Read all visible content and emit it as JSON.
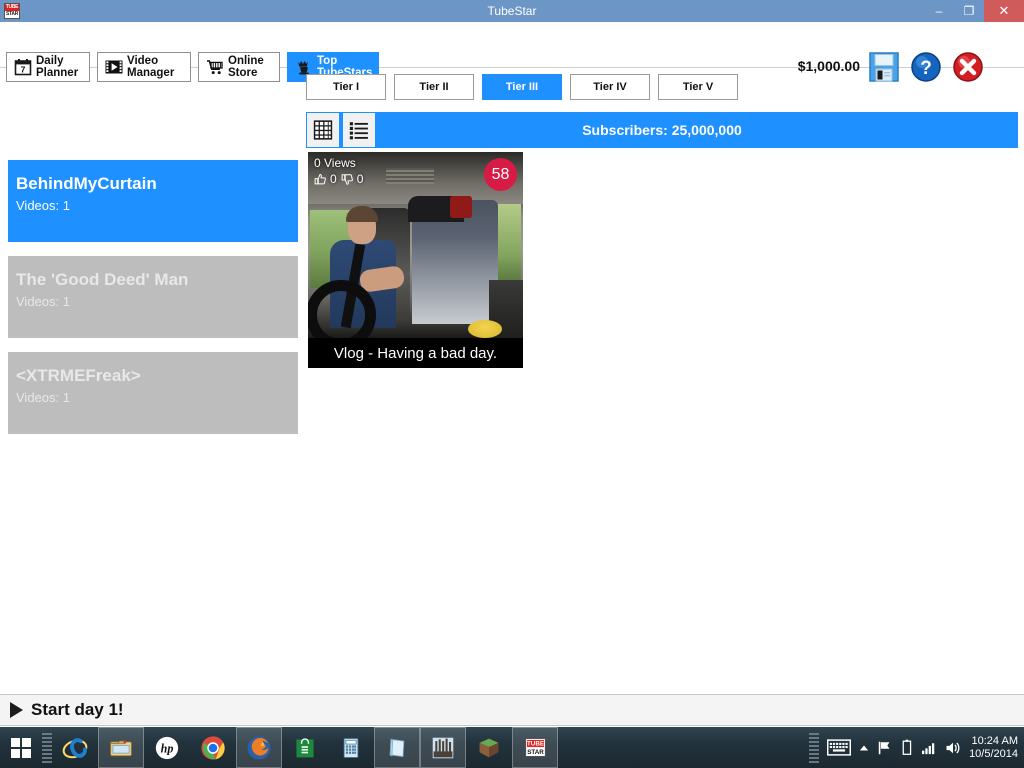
{
  "window": {
    "title": "TubeStar",
    "app_icon": "tubestar-icon",
    "minimize_label": "–",
    "maximize_label": "❐",
    "close_label": "✕"
  },
  "toolbar": {
    "buttons": [
      {
        "label": "Daily Planner",
        "icon": "calendar-icon",
        "active": false
      },
      {
        "label": "Video Manager",
        "icon": "film-strip-icon",
        "active": false
      },
      {
        "label": "Online Store",
        "icon": "shopping-cart-icon",
        "active": false
      },
      {
        "label": "Top TubeStars",
        "icon": "chess-queen-icon",
        "active": true
      }
    ],
    "money": "$1,000.00",
    "save_icon": "floppy-disk-save-icon",
    "help_icon": "question-mark-help-icon",
    "exit_icon": "red-x-close-icon"
  },
  "channels": [
    {
      "name": "BehindMyCurtain",
      "videos": "Videos: 1",
      "selected": true
    },
    {
      "name": "The 'Good Deed' Man",
      "videos": "Videos: 1",
      "selected": false
    },
    {
      "name": "<XTRMEFreak>",
      "videos": "Videos: 1",
      "selected": false
    }
  ],
  "tiers": [
    {
      "label": "Tier I",
      "active": false
    },
    {
      "label": "Tier II",
      "active": false
    },
    {
      "label": "Tier III",
      "active": true
    },
    {
      "label": "Tier IV",
      "active": false
    },
    {
      "label": "Tier V",
      "active": false
    }
  ],
  "channel_header": {
    "subscribers": "Subscribers: 25,000,000",
    "grid_view_icon": "grid-view-icon",
    "list_view_icon": "list-view-icon"
  },
  "video": {
    "views": "0 Views",
    "likes": "0",
    "dislikes": "0",
    "like_icon": "thumbs-up-icon",
    "dislike_icon": "thumbs-down-icon",
    "score": "58",
    "title": "Vlog - Having a bad day."
  },
  "status": {
    "start_label": "Start day 1!",
    "play_icon": "play-triangle-icon"
  },
  "taskbar": {
    "start_icon": "windows-start-icon",
    "items": [
      {
        "icon": "internet-explorer-icon",
        "label": "Internet Explorer",
        "boxed": false
      },
      {
        "icon": "file-explorer-icon",
        "label": "File Explorer",
        "boxed": true
      },
      {
        "icon": "hp-icon",
        "label": "HP",
        "boxed": false
      },
      {
        "icon": "google-chrome-icon",
        "label": "Google Chrome",
        "boxed": false
      },
      {
        "icon": "mozilla-firefox-icon",
        "label": "Mozilla Firefox",
        "boxed": true
      },
      {
        "icon": "windows-store-icon",
        "label": "Store",
        "boxed": false
      },
      {
        "icon": "calculator-icon",
        "label": "Calculator",
        "boxed": false
      },
      {
        "icon": "notepad-icon",
        "label": "Notepad",
        "boxed": true
      },
      {
        "icon": "factory-icon",
        "label": "Factory Game",
        "boxed": true
      },
      {
        "icon": "minecraft-grass-block-icon",
        "label": "Minecraft",
        "boxed": false
      },
      {
        "icon": "tubestar-icon",
        "label": "TubeStar",
        "boxed": true
      }
    ],
    "tray": {
      "keyboard_icon": "on-screen-keyboard-icon",
      "show_hidden_icon": "show-hidden-icons-chevron",
      "flag_icon": "action-center-flag-icon",
      "battery_icon": "battery-icon",
      "network_icon": "wifi-signal-icon",
      "volume_icon": "volume-speaker-icon",
      "time": "10:24 AM",
      "date": "10/5/2014"
    }
  },
  "colors": {
    "accent_blue": "#1e90ff",
    "titlebar_blue": "#6b96c6",
    "channel_gray": "#bdbdbd",
    "badge_red": "#d81b45",
    "close_red": "#cf5b5b"
  }
}
